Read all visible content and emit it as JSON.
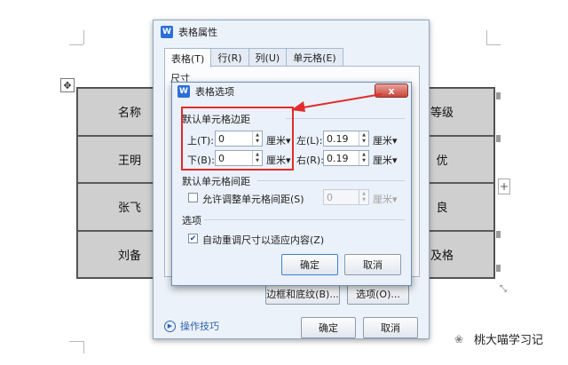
{
  "document_table": {
    "rows": [
      [
        "名称",
        "等级"
      ],
      [
        "王明",
        "优"
      ],
      [
        "张飞",
        "良"
      ],
      [
        "刘备",
        "及格"
      ]
    ]
  },
  "table_properties_dialog": {
    "title": "表格属性",
    "app_icon": "W",
    "tabs": [
      "表格(T)",
      "行(R)",
      "列(U)",
      "单元格(E)"
    ],
    "section_label": "尺寸",
    "borders_button": "边框和底纹(B)...",
    "options_button": "选项(O)...",
    "tips_link": "操作技巧",
    "ok_button": "确定",
    "cancel_button": "取消"
  },
  "table_options_dialog": {
    "title": "表格选项",
    "close_icon": "x",
    "cell_margins": {
      "label": "默认单元格边距",
      "top_label": "上(T):",
      "top_value": "0",
      "bottom_label": "下(B):",
      "bottom_value": "0",
      "left_label": "左(L):",
      "left_value": "0.19",
      "right_label": "右(R):",
      "right_value": "0.19",
      "unit": "厘米"
    },
    "cell_spacing": {
      "label": "默认单元格间距",
      "allow_label": "允许调整单元格间距(S)",
      "checked": false,
      "value": "0",
      "unit": "厘米"
    },
    "options": {
      "label": "选项",
      "autofit_label": "自动重调尺寸以适应内容(Z)",
      "checked": true
    },
    "ok_button": "确定",
    "cancel_button": "取消"
  },
  "watermark": "桃大喵学习记",
  "colors": {
    "highlight": "#e22b2b",
    "close_button": "#c9453a",
    "dialog_bg": "#eaf1fa",
    "table_cell": "#cfcfcf"
  }
}
